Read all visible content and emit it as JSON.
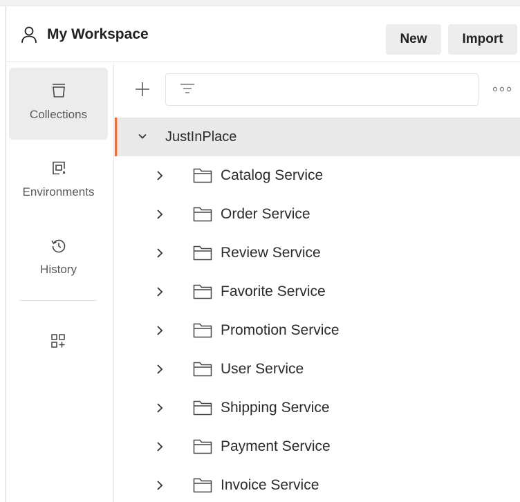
{
  "header": {
    "workspace_name": "My Workspace",
    "new_label": "New",
    "import_label": "Import"
  },
  "sidebar": {
    "items": [
      {
        "label": "Collections",
        "icon": "collections-icon",
        "active": true
      },
      {
        "label": "Environments",
        "icon": "environments-icon",
        "active": false
      },
      {
        "label": "History",
        "icon": "history-icon",
        "active": false
      }
    ],
    "more_icon": "add-apps-icon"
  },
  "toolbar": {
    "search_value": "",
    "search_placeholder": ""
  },
  "tree": {
    "collection": {
      "name": "JustInPlace",
      "expanded": true
    },
    "folders": [
      {
        "name": "Catalog Service"
      },
      {
        "name": "Order Service"
      },
      {
        "name": "Review Service"
      },
      {
        "name": "Favorite Service"
      },
      {
        "name": "Promotion Service"
      },
      {
        "name": "User Service"
      },
      {
        "name": "Shipping Service"
      },
      {
        "name": "Payment Service"
      },
      {
        "name": "Invoice Service"
      }
    ]
  },
  "colors": {
    "accent": "#f26b3a",
    "active_bg": "#ececec",
    "selected_row_bg": "#e9e9e9"
  }
}
